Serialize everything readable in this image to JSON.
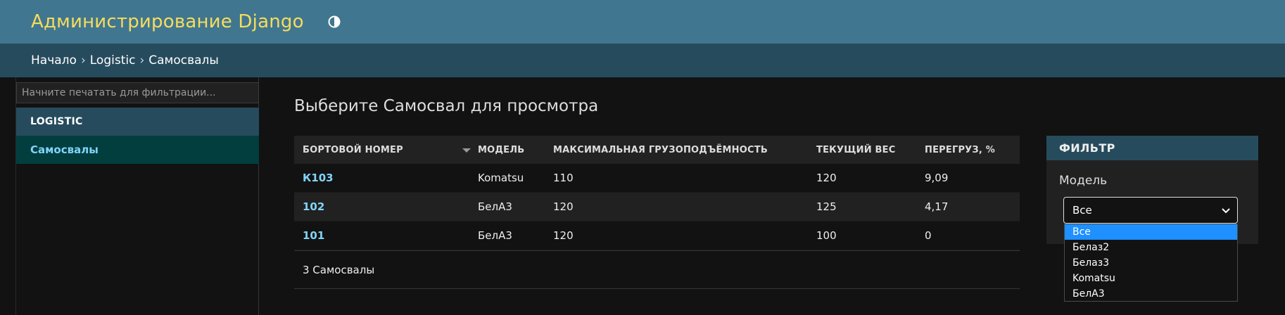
{
  "header": {
    "title": "Администрирование Django",
    "theme_icon": "contrast-toggle-icon"
  },
  "breadcrumbs": {
    "home": "Начало",
    "app": "Logistic",
    "current": "Самосвалы",
    "separator": "›"
  },
  "sidebar": {
    "filter_placeholder": "Начните печатать для фильтрации...",
    "app_caption": "LOGISTIC",
    "items": [
      {
        "label": "Самосвалы"
      }
    ]
  },
  "main": {
    "title": "Выберите Самосвал для просмотра",
    "columns": [
      "БОРТОВОЙ НОМЕР",
      "МОДЕЛЬ",
      "МАКСИМАЛЬНАЯ ГРУЗОПОДЪЁМНОСТЬ",
      "ТЕКУЩИЙ ВЕС",
      "ПЕРЕГРУЗ, %"
    ],
    "rows": [
      {
        "number": "К103",
        "model": "Komatsu",
        "capacity": "110",
        "weight": "120",
        "overload": "9,09"
      },
      {
        "number": "102",
        "model": "БелА3",
        "capacity": "120",
        "weight": "125",
        "overload": "4,17"
      },
      {
        "number": "101",
        "model": "БелА3",
        "capacity": "120",
        "weight": "100",
        "overload": "0"
      }
    ],
    "paginator": "3 Самосвалы"
  },
  "filter": {
    "title": "ФИЛЬТР",
    "label": "Модель",
    "selected": "Все",
    "options": [
      "Все",
      "Белаз2",
      "Белаз3",
      "Komatsu",
      "БелА3"
    ]
  },
  "colors": {
    "header_bg": "#417690",
    "brand": "#f5dd5d",
    "breadcrumb_bg": "#264b5d",
    "link": "#81d4fa",
    "selected_option": "#1e90ff"
  }
}
